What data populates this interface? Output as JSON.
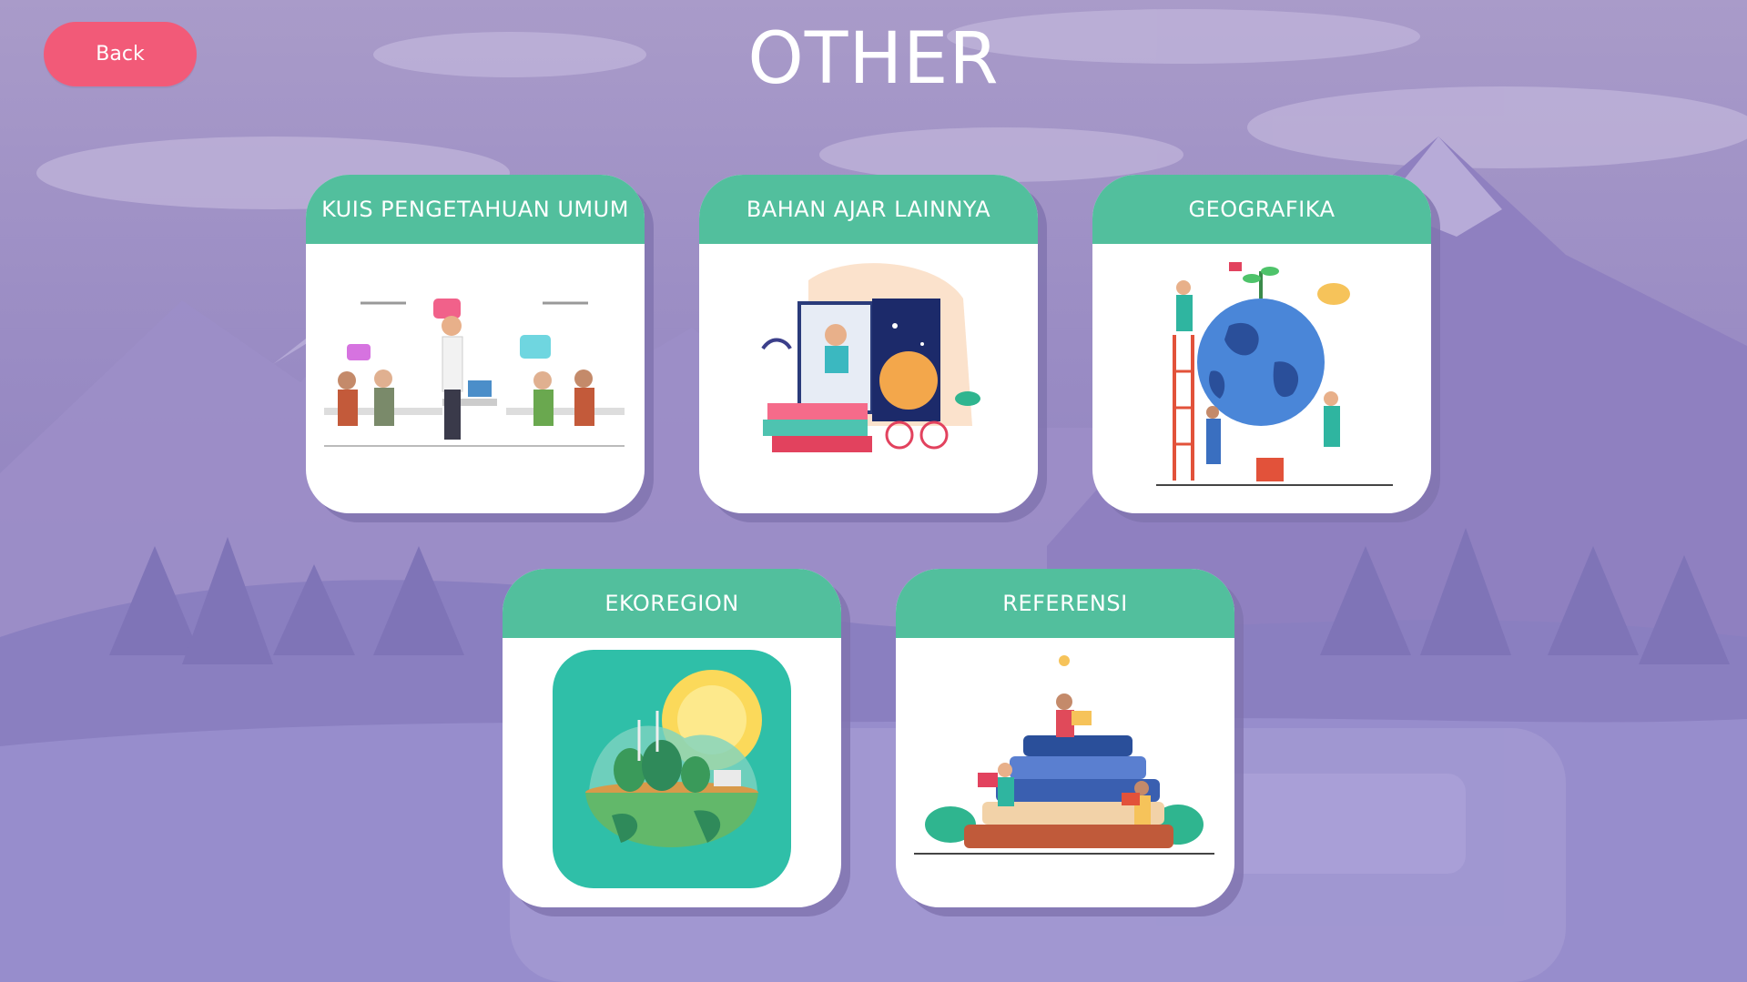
{
  "page": {
    "title": "OTHER",
    "back_label": "Back"
  },
  "cards": [
    {
      "label": "KUIS PENGETAHUAN UMUM",
      "icon": "office-people-illustration"
    },
    {
      "label": "BAHAN AJAR LAINNYA",
      "icon": "reading-book-illustration"
    },
    {
      "label": "GEOGRAFIKA",
      "icon": "globe-people-illustration"
    },
    {
      "label": "EKOREGION",
      "icon": "eco-globe-illustration"
    },
    {
      "label": "REFERENSI",
      "icon": "books-stack-illustration"
    }
  ],
  "colors": {
    "accent_green": "#52bf9d",
    "back_button": "#f25a78",
    "background": "#9a8cc4"
  }
}
